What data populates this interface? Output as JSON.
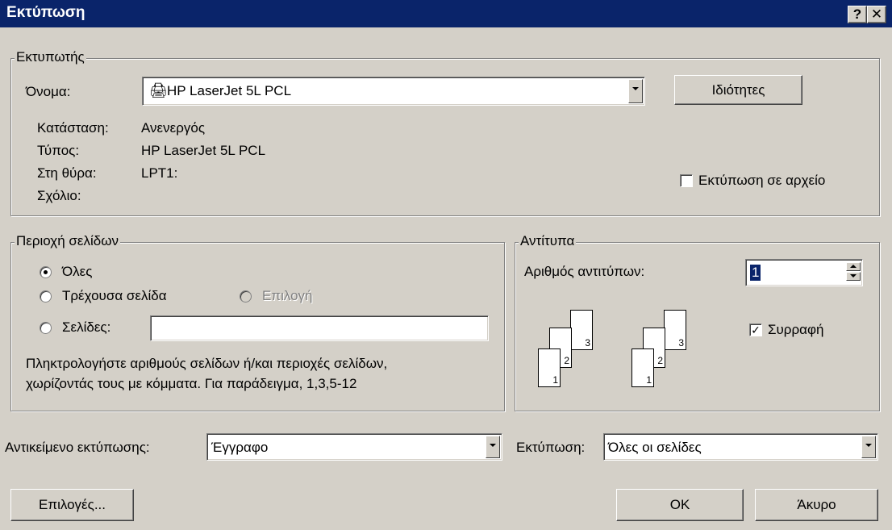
{
  "window": {
    "title": "Εκτύπωση",
    "help_button": "?",
    "close_button": "✕"
  },
  "printer": {
    "group_label": "Εκτυπωτής",
    "name_label": "Όνομα:",
    "name_value": "HP LaserJet 5L PCL",
    "properties_button": "Ιδιότητες",
    "status_label": "Κατάσταση:",
    "status_value": "Ανενεργός",
    "type_label": "Τύπος:",
    "type_value": "HP LaserJet 5L PCL",
    "port_label": "Στη θύρα:",
    "port_value": "LPT1:",
    "comment_label": "Σχόλιο:",
    "print_to_file_label": "Εκτύπωση σε αρχείο",
    "print_to_file_checked": false
  },
  "page_range": {
    "group_label": "Περιοχή σελίδων",
    "all_label": "Όλες",
    "current_label": "Τρέχουσα σελίδα",
    "selection_label": "Επιλογή",
    "pages_label": "Σελίδες:",
    "pages_value": "",
    "selected": "all",
    "hint_line1": "Πληκτρολογήστε αριθμούς σελίδων ή/και περιοχές σελίδων,",
    "hint_line2": "χωρίζοντάς τους με κόμματα. Για παράδειγμα, 1,3,5-12"
  },
  "copies": {
    "group_label": "Αντίτυπα",
    "count_label": "Αριθμός αντιτύπων:",
    "count_value": "1",
    "collate_label": "Συρραφή",
    "collate_checked": true,
    "page_numbers": [
      "3",
      "2",
      "1"
    ]
  },
  "print_what": {
    "label": "Αντικείμενο εκτύπωσης:",
    "value": "Έγγραφο"
  },
  "print": {
    "label": "Εκτύπωση:",
    "value": "Όλες οι σελίδες"
  },
  "buttons": {
    "options": "Επιλογές...",
    "ok": "OK",
    "cancel": "Άκυρο"
  },
  "colors": {
    "titlebar": "#0a246a",
    "face": "#d4d0c8"
  }
}
